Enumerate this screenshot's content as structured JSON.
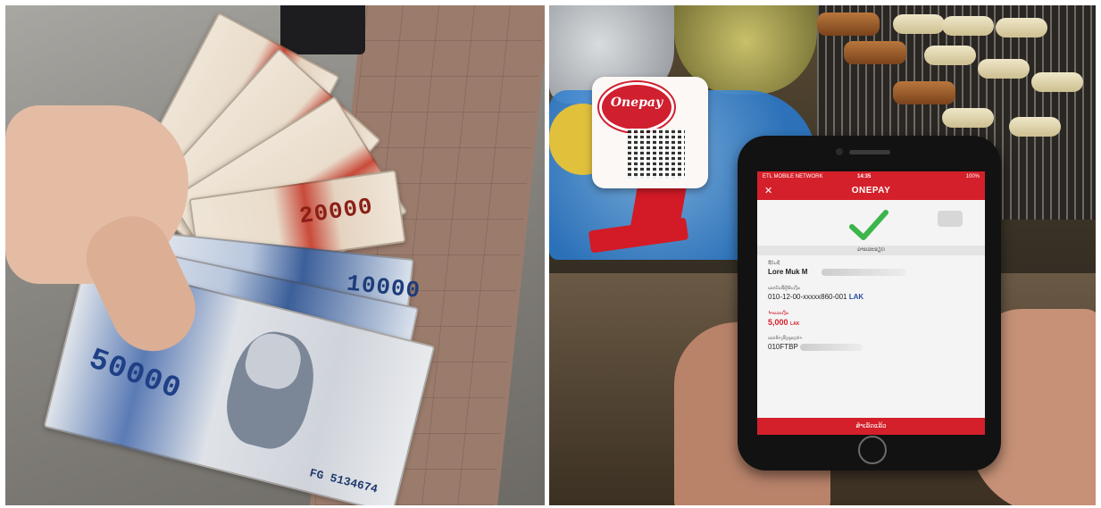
{
  "left_photo": {
    "banknotes": [
      {
        "value": "20000"
      },
      {
        "value": "20000"
      },
      {
        "value": "20000"
      },
      {
        "value": "20000"
      },
      {
        "value": "10000"
      },
      {
        "value": "10000"
      },
      {
        "value": "50000"
      }
    ],
    "serial": "FG 5134674"
  },
  "right_photo": {
    "stand": {
      "logo": "Onepay"
    },
    "phone": {
      "status": {
        "carrier": "ETL MOBILE NETWORK",
        "time": "14:35",
        "battery": "100%"
      },
      "app_title": "ONEPAY",
      "section_header": "ລາຍລະອຽດ",
      "fields": [
        {
          "label": "ຊື່ບັນຊີ",
          "value": "Lore Muk M"
        },
        {
          "label": "ເລກບັນຊີຜູ້ຮັບເງິນ",
          "value": "010-12-00-xxxxx860-001",
          "currency": "LAK"
        },
        {
          "label": "ຈຳນວນເງິນ",
          "value": "5,000",
          "currency": "LAK"
        },
        {
          "label": "ເລກອ້າງອີງທຸລະກຳ",
          "value": "010FTBP"
        }
      ],
      "bottom_button": "ສຳເລັດແລ້ວ"
    }
  }
}
